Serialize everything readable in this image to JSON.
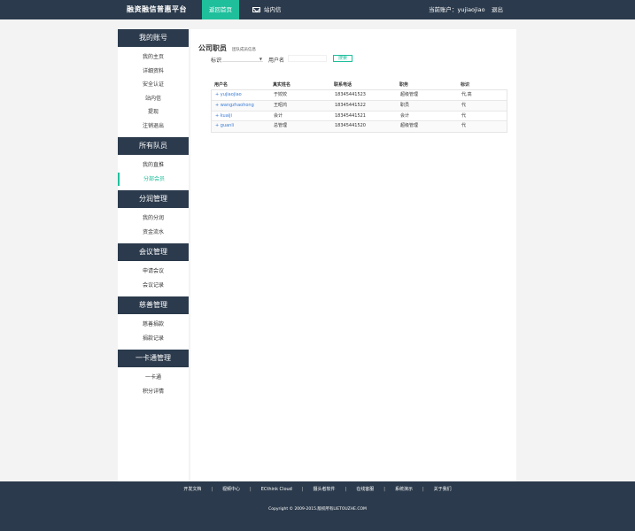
{
  "header": {
    "brand": "融资融信普惠平台",
    "nav_home": "返回首页",
    "nav_messages": "站内信",
    "account_label": "当前账户：yujiaojiao",
    "logout": "退出"
  },
  "sidebar": {
    "sections": [
      {
        "title": "我的账号",
        "items": [
          "我的主页",
          "详细资料",
          "安全认证",
          "站内信",
          "提现",
          "注销退出"
        ]
      },
      {
        "title": "所有队员",
        "items": [
          "我的直推",
          "分部会员"
        ]
      },
      {
        "title": "分润管理",
        "items": [
          "我的分润",
          "资金流水"
        ]
      },
      {
        "title": "会议管理",
        "items": [
          "申请会议",
          "会议记录"
        ]
      },
      {
        "title": "慈善管理",
        "items": [
          "慈善捐款",
          "捐款记录"
        ]
      },
      {
        "title": "一卡通管理",
        "items": [
          "一卡通",
          "积分详情"
        ]
      }
    ],
    "active_item": "分部会员"
  },
  "main": {
    "title": "公司职员",
    "subtitle": "团队成员信息",
    "filter": {
      "tag_label": "标识",
      "tag_select_value": "",
      "username_label": "用户名",
      "username_value": "",
      "search_button": "搜索"
    },
    "table": {
      "columns": [
        "用户名",
        "真实姓名",
        "联系电话",
        "职务",
        "标识"
      ],
      "rows": [
        [
          "+ yujiaojiao",
          "于姣姣",
          "18345441523",
          "超级管理",
          "代,高"
        ],
        [
          "+ wangzhaohong",
          "王昭鸿",
          "18345441522",
          "职员",
          "代"
        ],
        [
          "+ kuaiji",
          "会计",
          "18345441521",
          "会计",
          "代"
        ],
        [
          "+ guanli",
          "总管理",
          "18345441520",
          "超级管理",
          "代"
        ]
      ]
    }
  },
  "footer": {
    "links": [
      "开发文档",
      "视频中心",
      "ECthink Cloud",
      "摄头者软件",
      "在线客服",
      "系统演示",
      "关于我们"
    ],
    "copyright": "Copyright © 2009-2015.版权所有LIETOUZHE.COM"
  },
  "colors": {
    "dark": "#2b3a4c",
    "accent": "#1fbf9c",
    "link": "#3a7bd5"
  },
  "icons": {
    "messages": "envelope-icon",
    "select": "caret-down-icon",
    "expand": "plus-icon"
  }
}
